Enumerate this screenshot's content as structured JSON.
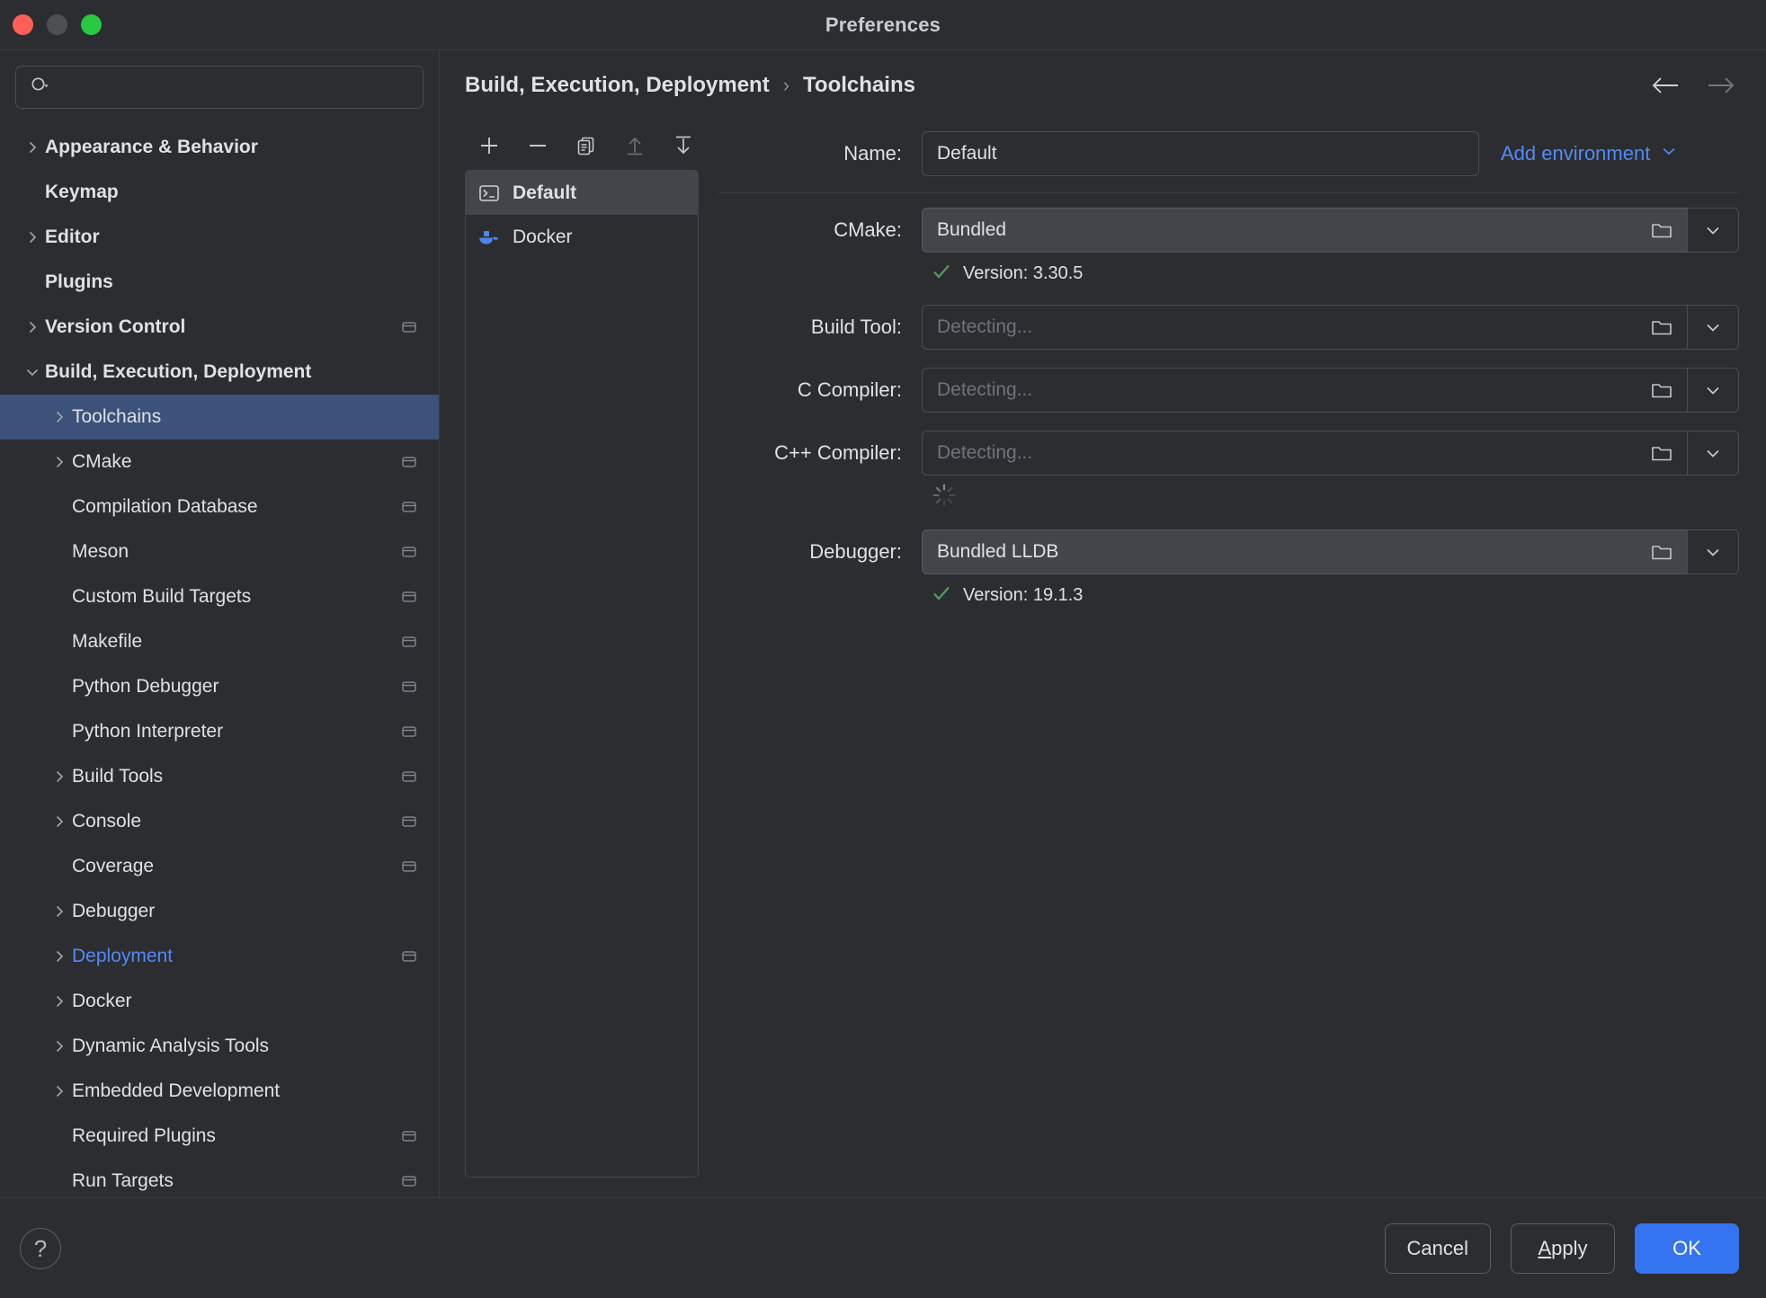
{
  "window": {
    "title": "Preferences",
    "traffic_lights": [
      "close",
      "minimize",
      "zoom"
    ]
  },
  "search": {
    "value": "",
    "placeholder": ""
  },
  "sidebar": {
    "items": [
      {
        "label": "Appearance & Behavior",
        "depth": 0,
        "twisty": "chevron-right",
        "badge": false,
        "selected": false,
        "blue": false
      },
      {
        "label": "Keymap",
        "depth": 0,
        "twisty": "none",
        "badge": false,
        "selected": false,
        "blue": false
      },
      {
        "label": "Editor",
        "depth": 0,
        "twisty": "chevron-right",
        "badge": false,
        "selected": false,
        "blue": false
      },
      {
        "label": "Plugins",
        "depth": 0,
        "twisty": "none",
        "badge": false,
        "selected": false,
        "blue": false
      },
      {
        "label": "Version Control",
        "depth": 0,
        "twisty": "chevron-right",
        "badge": true,
        "selected": false,
        "blue": false
      },
      {
        "label": "Build, Execution, Deployment",
        "depth": 0,
        "twisty": "chevron-down",
        "badge": false,
        "selected": false,
        "blue": false
      },
      {
        "label": "Toolchains",
        "depth": 1,
        "twisty": "chevron-right",
        "badge": false,
        "selected": true,
        "blue": false
      },
      {
        "label": "CMake",
        "depth": 1,
        "twisty": "chevron-right",
        "badge": true,
        "selected": false,
        "blue": false
      },
      {
        "label": "Compilation Database",
        "depth": 1,
        "twisty": "none",
        "badge": true,
        "selected": false,
        "blue": false
      },
      {
        "label": "Meson",
        "depth": 1,
        "twisty": "none",
        "badge": true,
        "selected": false,
        "blue": false
      },
      {
        "label": "Custom Build Targets",
        "depth": 1,
        "twisty": "none",
        "badge": true,
        "selected": false,
        "blue": false
      },
      {
        "label": "Makefile",
        "depth": 1,
        "twisty": "none",
        "badge": true,
        "selected": false,
        "blue": false
      },
      {
        "label": "Python Debugger",
        "depth": 1,
        "twisty": "none",
        "badge": true,
        "selected": false,
        "blue": false
      },
      {
        "label": "Python Interpreter",
        "depth": 1,
        "twisty": "none",
        "badge": true,
        "selected": false,
        "blue": false
      },
      {
        "label": "Build Tools",
        "depth": 1,
        "twisty": "chevron-right",
        "badge": true,
        "selected": false,
        "blue": false
      },
      {
        "label": "Console",
        "depth": 1,
        "twisty": "chevron-right",
        "badge": true,
        "selected": false,
        "blue": false
      },
      {
        "label": "Coverage",
        "depth": 1,
        "twisty": "none",
        "badge": true,
        "selected": false,
        "blue": false
      },
      {
        "label": "Debugger",
        "depth": 1,
        "twisty": "chevron-right",
        "badge": false,
        "selected": false,
        "blue": false
      },
      {
        "label": "Deployment",
        "depth": 1,
        "twisty": "chevron-right",
        "badge": true,
        "selected": false,
        "blue": true
      },
      {
        "label": "Docker",
        "depth": 1,
        "twisty": "chevron-right",
        "badge": false,
        "selected": false,
        "blue": false
      },
      {
        "label": "Dynamic Analysis Tools",
        "depth": 1,
        "twisty": "chevron-right",
        "badge": false,
        "selected": false,
        "blue": false
      },
      {
        "label": "Embedded Development",
        "depth": 1,
        "twisty": "chevron-right",
        "badge": false,
        "selected": false,
        "blue": false
      },
      {
        "label": "Required Plugins",
        "depth": 1,
        "twisty": "none",
        "badge": true,
        "selected": false,
        "blue": false
      },
      {
        "label": "Run Targets",
        "depth": 1,
        "twisty": "none",
        "badge": true,
        "selected": false,
        "blue": false
      }
    ]
  },
  "breadcrumb": {
    "parent": "Build, Execution, Deployment",
    "separator": "›",
    "current": "Toolchains"
  },
  "nav": {
    "back_icon": "arrow-left-icon",
    "forward_icon": "arrow-right-icon",
    "back_enabled": true,
    "forward_enabled": false
  },
  "list_toolbar": {
    "buttons": [
      {
        "name": "add-toolchain-button",
        "icon": "plus-icon",
        "enabled": true
      },
      {
        "name": "remove-toolchain-button",
        "icon": "minus-icon",
        "enabled": true
      },
      {
        "name": "copy-toolchain-button",
        "icon": "copy-icon",
        "enabled": true
      },
      {
        "name": "move-up-button",
        "icon": "arrow-up-icon",
        "enabled": false
      },
      {
        "name": "move-down-button",
        "icon": "arrow-down-icon",
        "enabled": true
      }
    ]
  },
  "toolchain_list": {
    "items": [
      {
        "label": "Default",
        "icon": "terminal-icon",
        "selected": true
      },
      {
        "label": "Docker",
        "icon": "docker-icon",
        "selected": false
      }
    ]
  },
  "form": {
    "name": {
      "label": "Name:",
      "value": "Default"
    },
    "add_environment": {
      "label": "Add environment",
      "chevron": "chevron-down-icon"
    },
    "cmake": {
      "label": "CMake:",
      "value": "Bundled",
      "placeholder": "",
      "filled": true,
      "status": {
        "icon": "check-icon",
        "text": "Version: 3.30.5",
        "color": "#4f9c54"
      }
    },
    "build_tool": {
      "label": "Build Tool:",
      "value": "",
      "placeholder": "Detecting...",
      "filled": false
    },
    "c_compiler": {
      "label": "C Compiler:",
      "value": "",
      "placeholder": "Detecting...",
      "filled": false
    },
    "cpp_compiler": {
      "label": "C++ Compiler:",
      "value": "",
      "placeholder": "Detecting...",
      "filled": false
    },
    "loading": {
      "icon": "spinner-icon"
    },
    "debugger": {
      "label": "Debugger:",
      "value": "Bundled LLDB",
      "placeholder": "",
      "filled": true,
      "status": {
        "icon": "check-icon",
        "text": "Version: 19.1.3",
        "color": "#4f9c54"
      }
    },
    "browse_icon": "folder-icon",
    "dropdown_icon": "chevron-down-icon"
  },
  "footer": {
    "help_label": "?",
    "cancel_label": "Cancel",
    "apply_label": "Apply",
    "apply_mnemonic": "A",
    "apply_rest": "pply",
    "ok_label": "OK"
  },
  "colors": {
    "accent": "#3574f0",
    "link": "#548af7",
    "selection": "#3c527a",
    "success": "#4f9c54",
    "window_bg": "#2b2d30",
    "field_filled": "#43454a"
  }
}
